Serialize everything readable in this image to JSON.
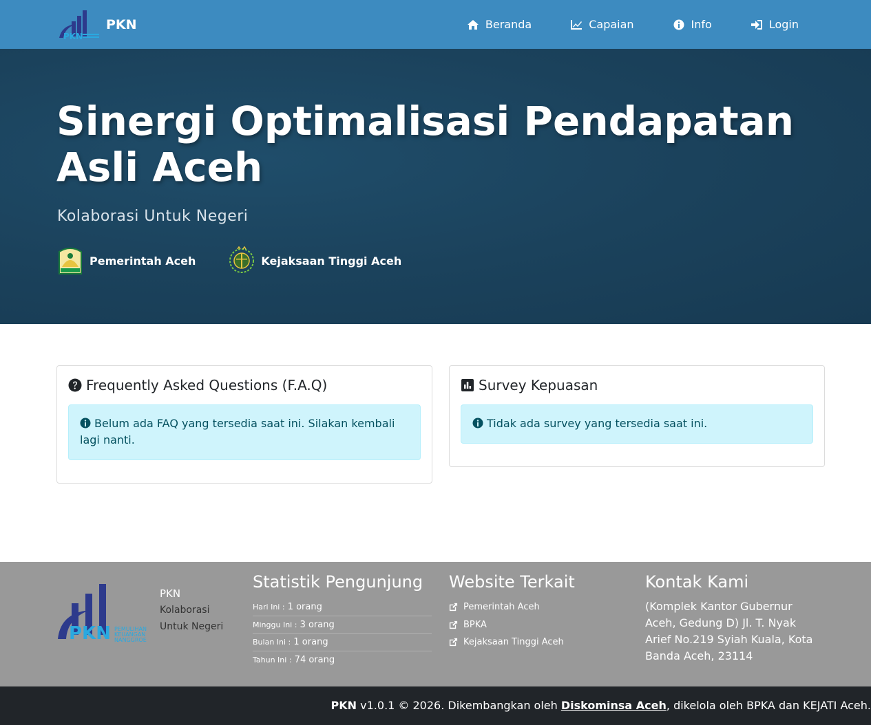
{
  "navbar": {
    "brand": "PKN",
    "items": [
      {
        "label": "Beranda",
        "icon": "home-icon"
      },
      {
        "label": "Capaian",
        "icon": "chart-line-icon"
      },
      {
        "label": "Info",
        "icon": "info-circle-icon"
      },
      {
        "label": "Login",
        "icon": "sign-in-icon"
      }
    ]
  },
  "hero": {
    "title": "Sinergi Optimalisasi Pendapatan Asli Aceh",
    "subtitle": "Kolaborasi Untuk Negeri",
    "partners": [
      {
        "label": "Pemerintah Aceh"
      },
      {
        "label": "Kejaksaan Tinggi Aceh"
      }
    ]
  },
  "faq": {
    "title": "Frequently Asked Questions (F.A.Q)",
    "message": "Belum ada FAQ yang tersedia saat ini. Silakan kembali lagi nanti."
  },
  "survey": {
    "title": "Survey Kepuasan",
    "message": "Tidak ada survey yang tersedia saat ini."
  },
  "footer": {
    "brand": "PKN",
    "tagline": "Kolaborasi Untuk Negeri",
    "stats": {
      "title": "Statistik Pengunjung",
      "rows": [
        {
          "label": "Hari Ini :",
          "value": "1 orang"
        },
        {
          "label": "Minggu Ini :",
          "value": "3 orang"
        },
        {
          "label": "Bulan Ini :",
          "value": "1 orang"
        },
        {
          "label": "Tahun Ini :",
          "value": "74 orang"
        }
      ]
    },
    "websites": {
      "title": "Website Terkait",
      "links": [
        "Pemerintah Aceh",
        "BPKA",
        "Kejaksaan Tinggi Aceh"
      ]
    },
    "contact": {
      "title": "Kontak Kami",
      "address": "(Komplek Kantor Gubernur Aceh, Gedung D) Jl. T. Nyak Arief No.219 Syiah Kuala, Kota Banda Aceh, 23114"
    }
  },
  "bottom": {
    "brand": "PKN",
    "text1": " v1.0.1 © 2026. Dikembangkan oleh ",
    "link": "Diskominsa Aceh",
    "text2": ", dikelola oleh BPKA dan KEJATI Aceh."
  },
  "colors": {
    "navbar": "#3d8bc0",
    "hero": "#1b425c",
    "alert_bg": "#cff4fc",
    "alert_text": "#055160",
    "footer": "#999999",
    "bottombar": "#212529"
  }
}
